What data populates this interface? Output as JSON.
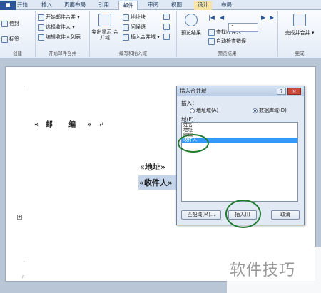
{
  "tabs": [
    "开始",
    "插入",
    "页面布局",
    "引用",
    "邮件",
    "审阅",
    "视图",
    "设计",
    "布局"
  ],
  "ribbon": {
    "create": {
      "label": "创建",
      "items": [
        "信封",
        "标签"
      ]
    },
    "start_merge": {
      "label": "开始邮件合并",
      "items": [
        "开始邮件合并 ▾",
        "选择收件人 ▾",
        "编辑收件人列表"
      ]
    },
    "write_insert": {
      "label": "编写和插入域",
      "highlight": "突出显示 合并域",
      "items": [
        "地址块",
        "问候语",
        "插入合并域 ▾"
      ]
    },
    "preview": {
      "label": "预览结果",
      "button": "预览结果",
      "record": "1",
      "items": [
        "查找收件人",
        "自动检查错误"
      ]
    },
    "finish": {
      "label": "完成",
      "button": "完成并合并 ▾"
    }
  },
  "document": {
    "zip_line": "« 邮   编  » ↵",
    "address_field": "«地址»",
    "recipient_field": "«收件人»"
  },
  "dialog": {
    "title": "插入合并域",
    "help": "?",
    "close": "×",
    "insert_label": "插入：",
    "radio_address": "地址域(A)",
    "radio_database": "数据库域(D)",
    "fields_label": "域(F)：",
    "fields": [
      "姓名",
      "地址",
      "邮编",
      "收件人"
    ],
    "selected_field": "收件人",
    "btn_match": "匹配域(M)...",
    "btn_insert": "插入(I)",
    "btn_cancel": "取消"
  },
  "watermark": "软件技巧",
  "colors": {
    "ribbon_accent": "#2b579a",
    "selection": "#3399ff",
    "annotation_ring": "#1f7a2e"
  }
}
